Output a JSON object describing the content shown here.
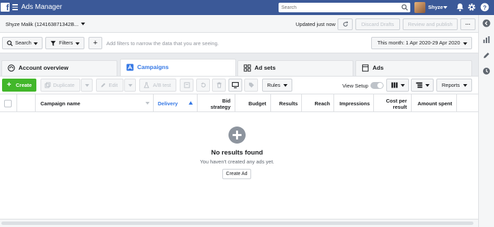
{
  "topbar": {
    "app_title": "Ads Manager",
    "logo_letter": "f",
    "search_placeholder": "Search",
    "user_name": "Shyze"
  },
  "account": {
    "name": "Shyze Malik (124163871342B...",
    "updated": "Updated just now",
    "discard_label": "Discard Drafts",
    "review_label": "Review and publish",
    "more_label": "···"
  },
  "filters": {
    "search_label": "Search",
    "filters_label": "Filters",
    "add_label": "+",
    "hint": "Add filters to narrow the data that you are seeing.",
    "date_range": "This month: 1 Apr 2020-29 Apr 2020"
  },
  "tabs": [
    {
      "label": "Account overview"
    },
    {
      "label": "Campaigns"
    },
    {
      "label": "Ad sets"
    },
    {
      "label": "Ads"
    }
  ],
  "toolbar": {
    "create_label": "Create",
    "duplicate_label": "Duplicate",
    "edit_label": "Edit",
    "ab_test_label": "A/B test",
    "rules_label": "Rules",
    "view_setup_label": "View Setup",
    "reports_label": "Reports"
  },
  "table": {
    "columns": [
      "Campaign name",
      "Delivery",
      "Bid strategy",
      "Budget",
      "Results",
      "Reach",
      "Impressions",
      "Cost per result",
      "Amount spent"
    ],
    "sorted_column": "Delivery"
  },
  "empty_state": {
    "title": "No results found",
    "subtitle": "You haven't created any ads yet.",
    "button_label": "Create Ad"
  },
  "colors": {
    "brand": "#3b5998",
    "accent": "#3578e5",
    "create_green": "#42b72a"
  }
}
